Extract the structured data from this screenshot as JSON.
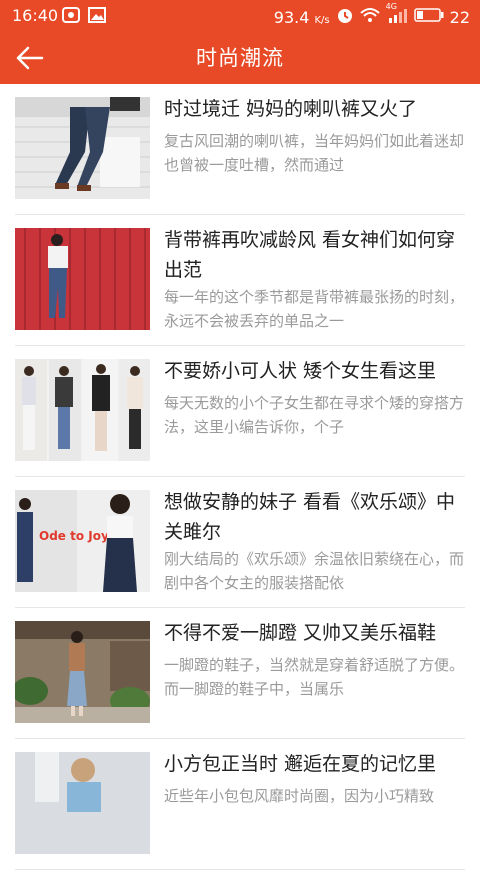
{
  "status_bar": {
    "time": "16:40",
    "speed": "93.4",
    "speed_unit": "K/s",
    "network": "4G",
    "battery": "22"
  },
  "header": {
    "title": "时尚潮流",
    "back_icon": "back-arrow-icon"
  },
  "articles": [
    {
      "title": "时过境迁 妈妈的喇叭裤又火了",
      "desc": "复古风回潮的喇叭裤，当年妈妈们如此着迷却也曾被一度吐槽，然而通过"
    },
    {
      "title": "背带裤再吹减龄风 看女神们如何穿出范",
      "desc": "每一年的这个季节都是背带裤最张扬的时刻，永远不会被丢弃的单品之一"
    },
    {
      "title": "不要娇小可人状 矮个女生看这里",
      "desc": "每天无数的小个子女生都在寻求个矮的穿搭方法，这里小编告诉你，个子"
    },
    {
      "title": "想做安静的妹子 看看《欢乐颂》中关雎尔",
      "desc": "刚大结局的《欢乐颂》余温依旧萦绕在心，而剧中各个女主的服装搭配依",
      "logo_text": "Ode to Joy"
    },
    {
      "title": "不得不爱一脚蹬 又帅又美乐福鞋",
      "desc": "一脚蹬的鞋子，当然就是穿着舒适脱了方便。而一脚蹬的鞋子中，当属乐"
    },
    {
      "title": "小方包正当时 邂逅在夏的记忆里",
      "desc": "近些年小包包风靡时尚圈，因为小巧精致"
    }
  ],
  "colors": {
    "accent": "#e84a27",
    "title_text": "#222222",
    "desc_text": "#9a9a9a",
    "divider": "#e6e6e6"
  }
}
